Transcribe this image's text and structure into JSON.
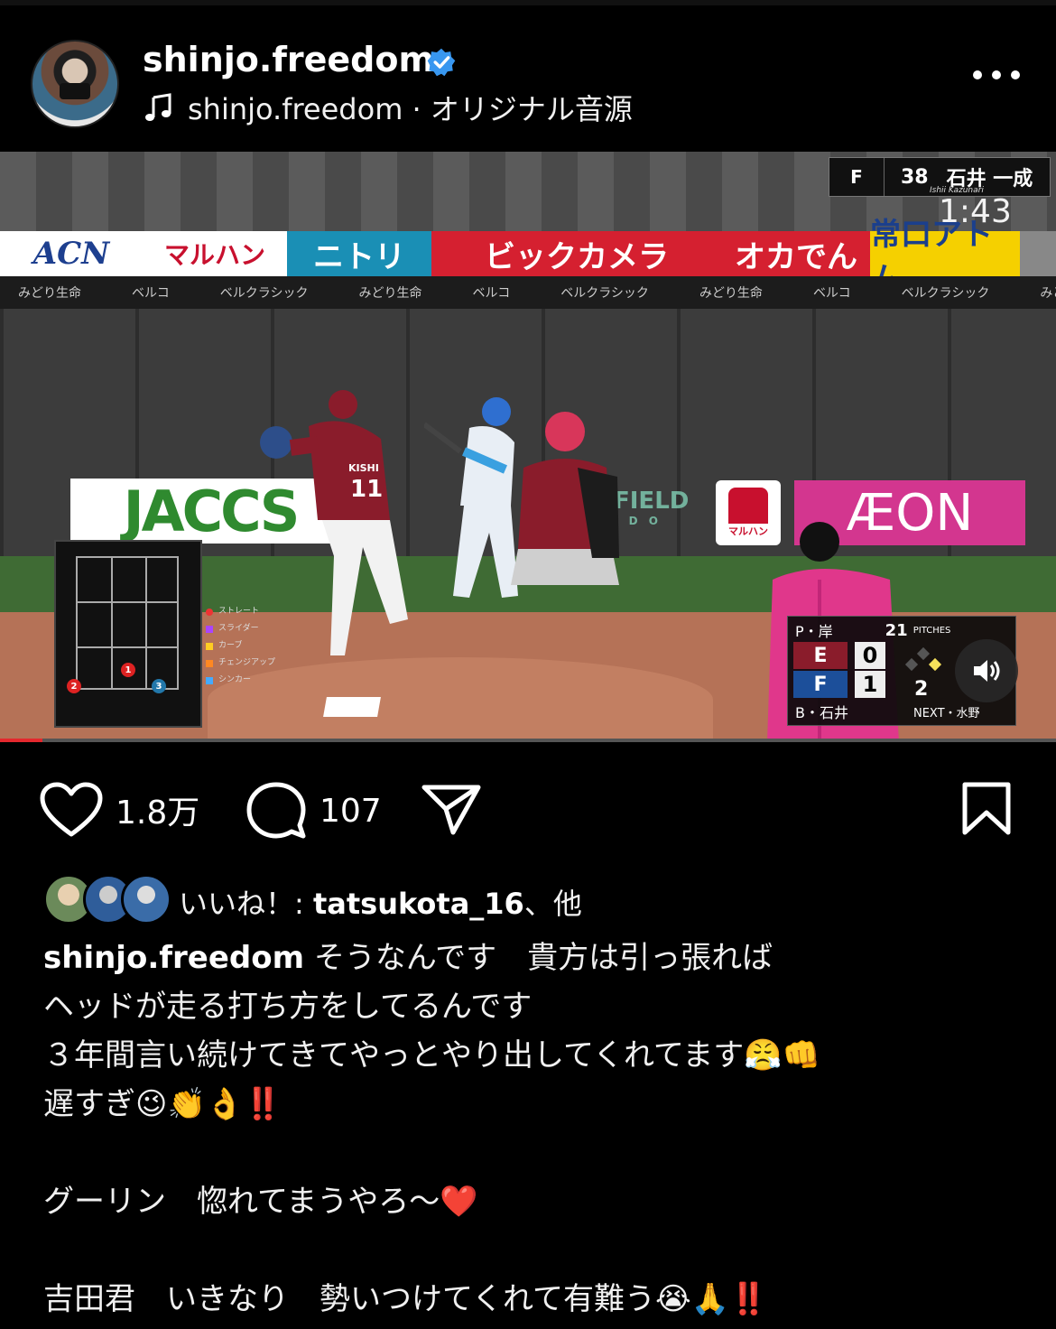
{
  "header": {
    "username": "shinjo.freedom",
    "audio": "shinjo.freedom · オリジナル音源",
    "verified_color": "#3897f0"
  },
  "video": {
    "ads": [
      "ACN",
      "マルハン",
      "ニトリ",
      "ビックカメラ",
      "オカでん",
      "常口アトム"
    ],
    "ad_colors": [
      "#ffffff",
      "#ffffff",
      "#1a8fb5",
      "#d52030",
      "#d52030",
      "#1b5fa8"
    ],
    "band2": [
      "みどり生命",
      "ベルコ",
      "ベルクラシック",
      "みどり生命",
      "ベルコ",
      "ベルクラシック",
      "みどり生命",
      "ベルコ",
      "ベルクラシック",
      "みどり生命"
    ],
    "wall_jaccs": "JACCS",
    "wall_field": "FIELD",
    "wall_field_sub": "I D O",
    "wall_maruhan": "マルハン",
    "wall_aeon": "ÆON",
    "pitcher_name": "KISHI",
    "pitcher_number": "11",
    "lineup_number": "38",
    "lineup_name": "石井 一成",
    "lineup_sub": "Ishii Kazunari",
    "timer": "1:43",
    "legend": [
      "ストレート",
      "スライダー",
      "カーブ",
      "チェンジアップ",
      "シンカー"
    ],
    "pitch_marks": [
      "2",
      "1",
      "3"
    ],
    "scoreboard": {
      "pitcher_label": "P・岸",
      "pitches": "21",
      "pitches_label": "PITCHES",
      "away_score": "0",
      "home_score": "1",
      "outs": "2",
      "batter_label": "B・石井",
      "next_label": "NEXT・水野"
    },
    "progress": 0.04
  },
  "actions": {
    "likes": "1.8万",
    "comments": "107"
  },
  "liked_by": {
    "prefix": "いいね！: ",
    "user": "tatsukota_16",
    "suffix": "、他"
  },
  "caption": {
    "user": "shinjo.freedom",
    "line1": " そうなんです　貴方は引っ張れば",
    "line2": "ヘッドが走る打ち方をしてるんです",
    "line3": "３年間言い続けてきてやっとやり出してくれてます😤👊",
    "line4": "遅すぎ😉👏👌‼️",
    "line5": "",
    "line6": "グーリン　惚れてまうやろ〜❤️",
    "line7": "",
    "line8": "吉田君　いきなり　勢いつけてくれて有難う😭🙏‼️"
  }
}
